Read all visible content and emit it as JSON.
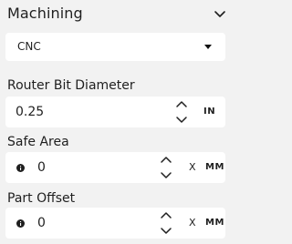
{
  "header": {
    "title": "Machining",
    "icon": "chevron-down-icon"
  },
  "machine_select": {
    "value": "CNC"
  },
  "fields": [
    {
      "label": "Router Bit Diameter",
      "value": "0.25",
      "unit": "IN"
    },
    {
      "label": "Safe Area",
      "value": "0",
      "separator": "X",
      "unit": "MM",
      "icon": "info-icon"
    },
    {
      "label": "Part Offset",
      "value": "0",
      "separator": "X",
      "unit": "MM",
      "icon": "info-icon"
    }
  ]
}
